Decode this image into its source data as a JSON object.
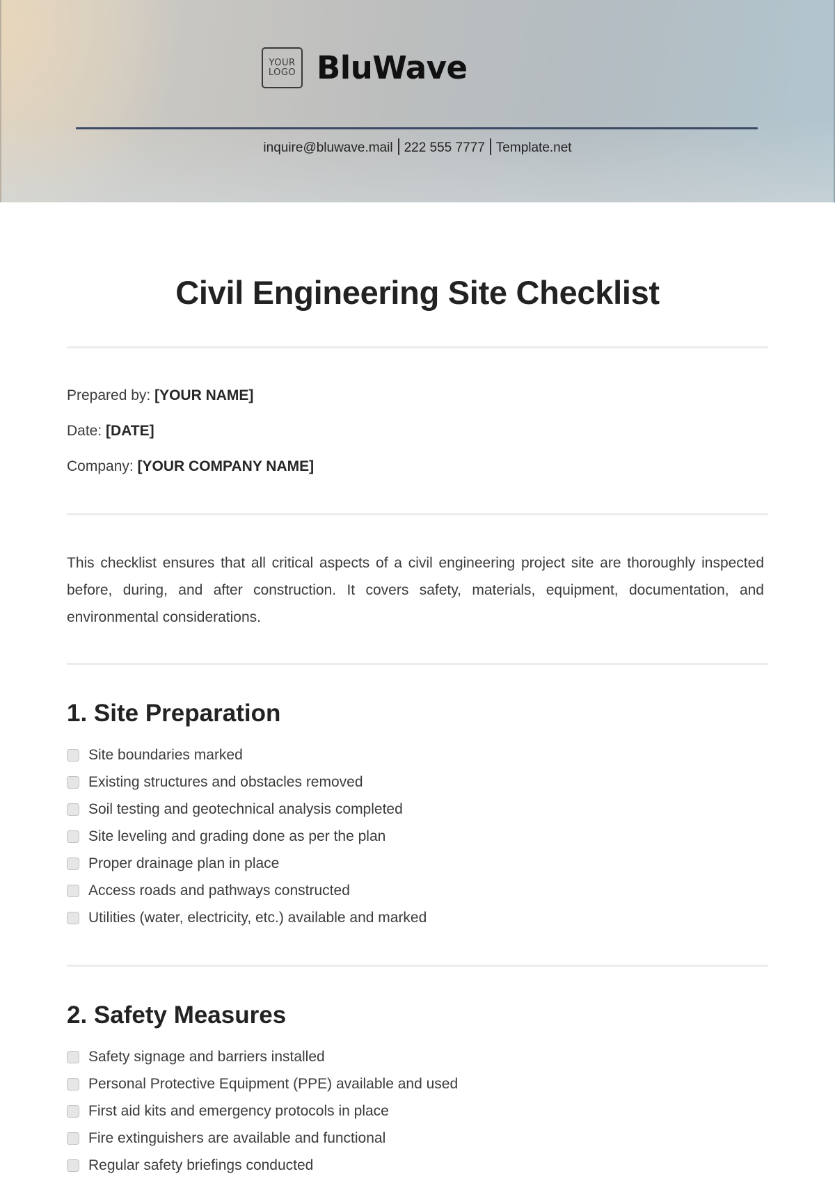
{
  "header": {
    "logo_line1": "YOUR",
    "logo_line2": "LOGO",
    "brand_name": "BluWave",
    "contact": {
      "email": "inquire@bluwave.mail",
      "phone": "222 555 7777",
      "website": "Template.net"
    }
  },
  "document": {
    "title": "Civil Engineering Site Checklist",
    "meta": [
      {
        "label": "Prepared by: ",
        "value": "[YOUR NAME]"
      },
      {
        "label": "Date: ",
        "value": "[DATE]"
      },
      {
        "label": "Company: ",
        "value": "[YOUR COMPANY NAME]"
      }
    ],
    "intro": "This checklist ensures that all critical aspects of a civil engineering project site are thoroughly inspected before, during, and after construction. It covers safety, materials, equipment, documentation, and environmental considerations.",
    "sections": [
      {
        "heading": "1. Site Preparation",
        "items": [
          {
            "label": "Site boundaries marked",
            "checked": false
          },
          {
            "label": "Existing structures and obstacles removed",
            "checked": false
          },
          {
            "label": "Soil testing and geotechnical analysis completed",
            "checked": false
          },
          {
            "label": "Site leveling and grading done as per the plan",
            "checked": false
          },
          {
            "label": "Proper drainage plan in place",
            "checked": false
          },
          {
            "label": "Access roads and pathways constructed",
            "checked": false
          },
          {
            "label": "Utilities (water, electricity, etc.) available and marked",
            "checked": false
          }
        ]
      },
      {
        "heading": "2. Safety Measures",
        "items": [
          {
            "label": "Safety signage and barriers installed",
            "checked": false
          },
          {
            "label": "Personal Protective Equipment (PPE) available and used",
            "checked": false
          },
          {
            "label": "First aid kits and emergency protocols in place",
            "checked": false
          },
          {
            "label": "Fire extinguishers are available and functional",
            "checked": false
          },
          {
            "label": "Regular safety briefings conducted",
            "checked": false
          }
        ]
      }
    ]
  }
}
